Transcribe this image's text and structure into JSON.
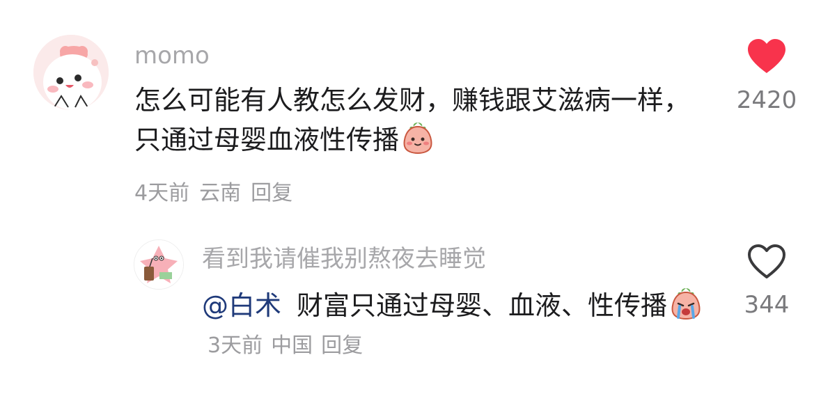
{
  "comment": {
    "username": "momo",
    "text": "怎么可能有人教怎么发财，赚钱跟艾滋病一样，只通过母婴血液性传播",
    "emoji_icon": "shy-peach-emoji-icon",
    "time": "4天前",
    "location": "云南",
    "reply_label": "回复",
    "like_count": "2420",
    "liked": true,
    "like_color": "#f8334c"
  },
  "reply": {
    "username": "看到我请催我别熬夜去睡觉",
    "mention": "@白术",
    "text": "财富只通过母婴、血液、性传播",
    "emoji_icon": "crying-peach-emoji-icon",
    "time": "3天前",
    "location": "中国",
    "reply_label": "回复",
    "like_count": "344",
    "liked": false
  }
}
